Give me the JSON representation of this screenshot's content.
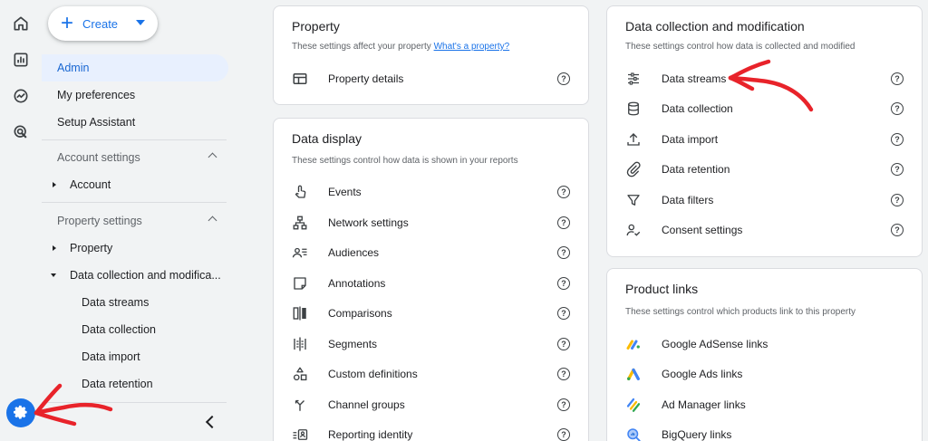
{
  "rail": {
    "icons": [
      "home-icon",
      "reports-icon",
      "explore-icon",
      "advertising-icon"
    ],
    "admin_icon": "gear-icon",
    "accent": "#1a73e8"
  },
  "nav": {
    "create_label": "Create",
    "items": [
      "Admin",
      "My preferences",
      "Setup Assistant"
    ],
    "account_section": "Account settings",
    "account_item": "Account",
    "property_section": "Property settings",
    "property_item": "Property",
    "data_collection_item": "Data collection and modifica...",
    "sub_items": [
      "Data streams",
      "Data collection",
      "Data import",
      "Data retention"
    ]
  },
  "property_card": {
    "title": "Property",
    "subtitle": "These settings affect your property",
    "link": "What's a property?",
    "rows": [
      {
        "label": "Property details",
        "icon": "property-details-icon"
      }
    ]
  },
  "display_card": {
    "title": "Data display",
    "subtitle": "These settings control how data is shown in your reports",
    "rows": [
      {
        "label": "Events",
        "icon": "events-icon"
      },
      {
        "label": "Network settings",
        "icon": "network-icon"
      },
      {
        "label": "Audiences",
        "icon": "audiences-icon"
      },
      {
        "label": "Annotations",
        "icon": "annotations-icon"
      },
      {
        "label": "Comparisons",
        "icon": "comparisons-icon"
      },
      {
        "label": "Segments",
        "icon": "segments-icon"
      },
      {
        "label": "Custom definitions",
        "icon": "custom-definitions-icon"
      },
      {
        "label": "Channel groups",
        "icon": "channel-groups-icon"
      },
      {
        "label": "Reporting identity",
        "icon": "reporting-identity-icon"
      }
    ]
  },
  "collection_card": {
    "title": "Data collection and modification",
    "subtitle": "These settings control how data is collected and modified",
    "rows": [
      {
        "label": "Data streams",
        "icon": "data-streams-icon"
      },
      {
        "label": "Data collection",
        "icon": "database-icon"
      },
      {
        "label": "Data import",
        "icon": "upload-icon"
      },
      {
        "label": "Data retention",
        "icon": "paperclip-icon"
      },
      {
        "label": "Data filters",
        "icon": "filter-icon"
      },
      {
        "label": "Consent settings",
        "icon": "consent-icon"
      }
    ]
  },
  "links_card": {
    "title": "Product links",
    "subtitle": "These settings control which products link to this property",
    "rows": [
      {
        "label": "Google AdSense links",
        "icon": "adsense-icon"
      },
      {
        "label": "Google Ads links",
        "icon": "google-ads-icon"
      },
      {
        "label": "Ad Manager links",
        "icon": "ad-manager-icon"
      },
      {
        "label": "BigQuery links",
        "icon": "bigquery-icon"
      }
    ]
  },
  "help_glyph": "?",
  "annotation_color": "#e8232a"
}
